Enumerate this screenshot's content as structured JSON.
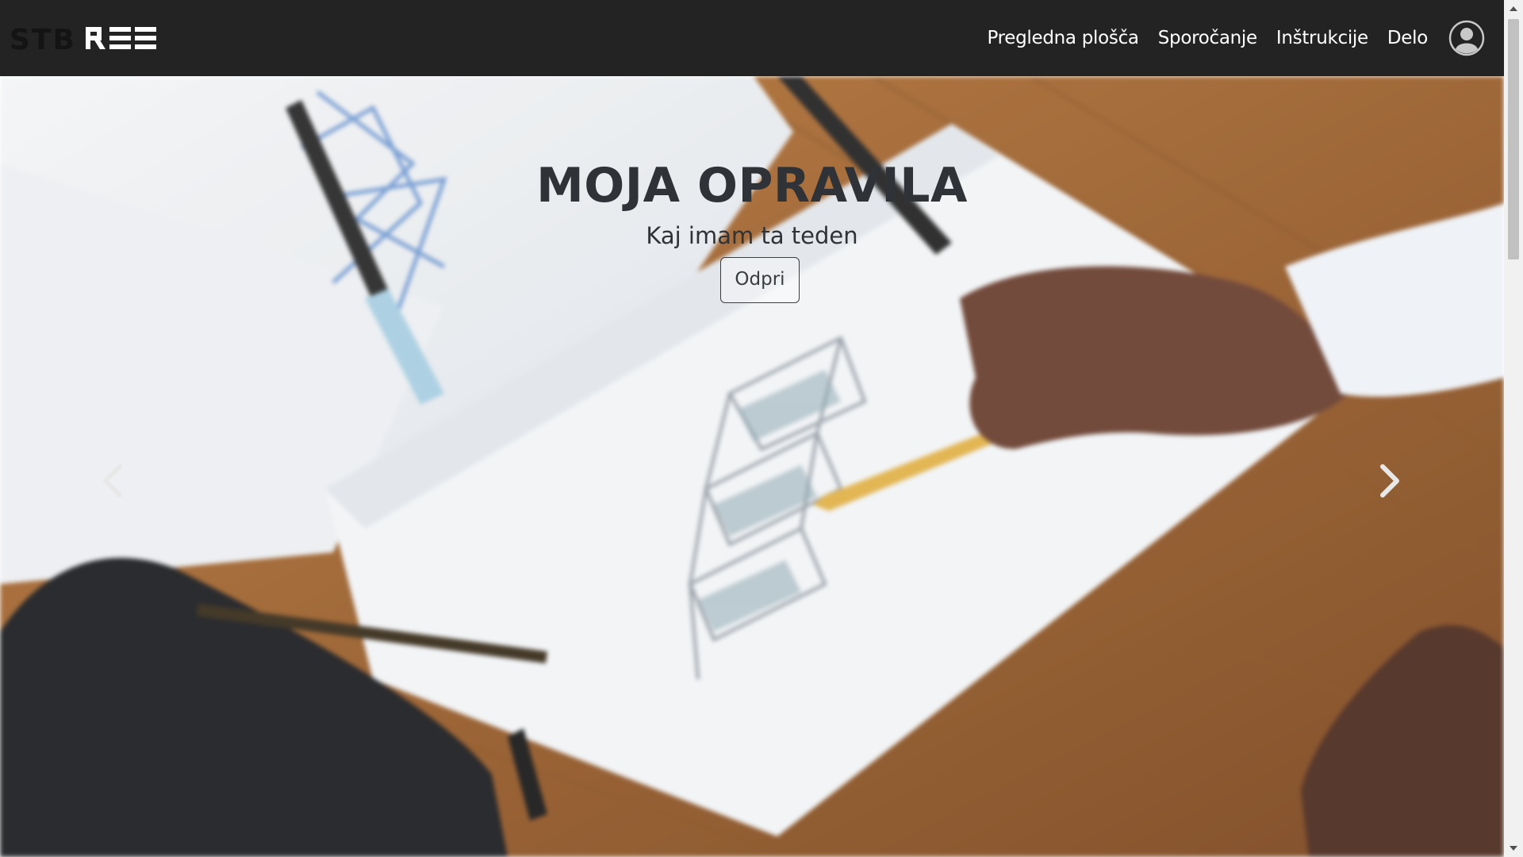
{
  "brand": {
    "logo_text": "STBREE"
  },
  "nav": {
    "items": [
      {
        "label": "Pregledna plošča"
      },
      {
        "label": "Sporočanje"
      },
      {
        "label": "Inštrukcije"
      },
      {
        "label": "Delo"
      }
    ],
    "avatar_icon": "user-circle-icon"
  },
  "hero": {
    "title": "MOJA OPRAVILA",
    "subtitle": "Kaj imam ta teden",
    "button_label": "Odpri",
    "prev_icon": "chevron-left-icon",
    "next_icon": "chevron-right-icon"
  },
  "colors": {
    "navbar": "#232323",
    "nav_text": "#ffffff",
    "caption_text": "#2f3338"
  }
}
